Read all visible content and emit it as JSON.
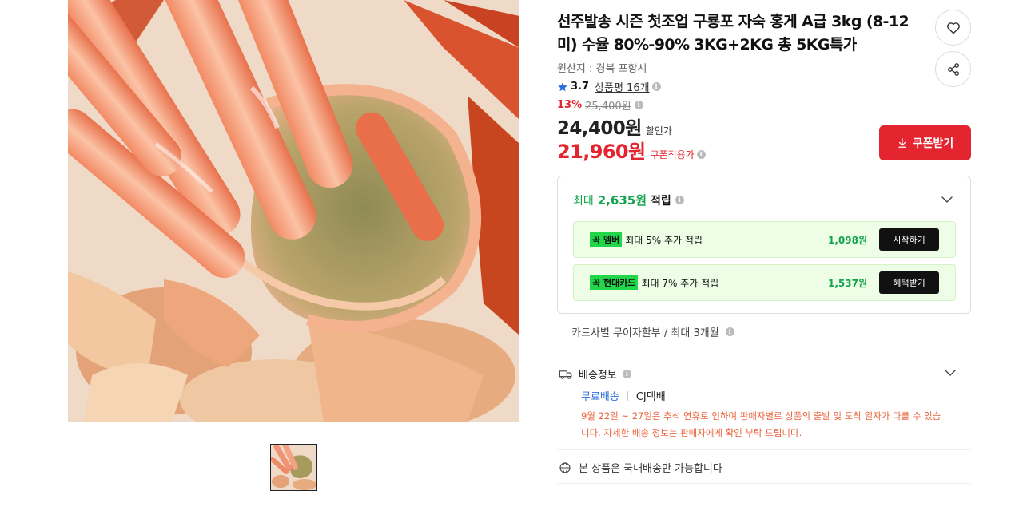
{
  "product": {
    "title": "선주발송 시즌 첫조업 구룡포 자숙 홍게 A급 3kg (8-12미) 수율 80%-90% 3KG+2KG 총 5KG특가",
    "origin": "원산지 : 경북 포항시",
    "rating_score": "3.7",
    "review_count": "상품평 16개",
    "discount_rate": "13%",
    "original_price": "25,400원",
    "sale_price": "24,400원",
    "sale_label": "할인가",
    "coupon_price": "21,960원",
    "coupon_label": "쿠폰적용가",
    "coupon_button": "쿠폰받기"
  },
  "rewards": {
    "prefix": "최대",
    "amount": "2,635원",
    "suffix": "적립",
    "items": [
      {
        "tag": "꼭 멤버",
        "desc": "최대 5% 추가 적립",
        "amount": "1,098원",
        "button": "시작하기"
      },
      {
        "tag": "꼭 현대카드",
        "desc": "최대 7% 추가 적립",
        "amount": "1,537원",
        "button": "혜택받기"
      }
    ]
  },
  "installment": "카드사별 무이자할부 / 최대 3개월",
  "shipping": {
    "title": "배송정보",
    "free": "무료배송",
    "carrier": "CJ택배",
    "notice": "9월 22일 ~ 27일은 추석 연휴로 인하여 판매자별로 상품의 출발 및 도착 일자가 다를 수 있습니다. 자세한 배송 정보는 판매자에게 확인 부탁 드립니다."
  },
  "domestic": "본 상품은 국내배송만 가능합니다",
  "colors": {
    "accent_red": "#e4252f",
    "reward_green": "#14a44d",
    "notice_orange": "#e8643c",
    "link_blue": "#2a6fdb"
  },
  "icons": [
    "heart-icon",
    "share-icon",
    "star-icon",
    "info-icon",
    "download-icon",
    "chevron-down-icon",
    "truck-icon",
    "globe-icon"
  ]
}
